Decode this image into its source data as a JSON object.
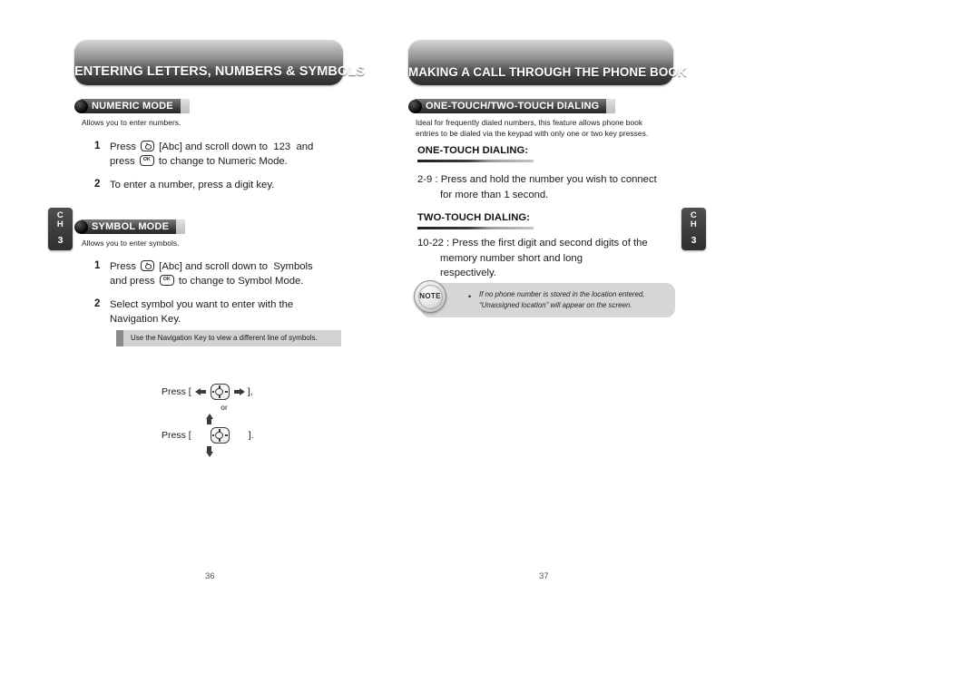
{
  "document": {
    "type": "phone-user-manual-spread"
  },
  "left_page": {
    "banner_title": "ENTERING LETTERS, NUMBERS & SYMBOLS",
    "page_number": "36",
    "chapter_tab": {
      "line1": "C",
      "line2": "H",
      "number": "3"
    },
    "sections": [
      {
        "badge_label": "NUMERIC MODE",
        "lead": "Allows you to enter numbers.",
        "steps": [
          {
            "num": "1",
            "parts": [
              {
                "kind": "text",
                "value": "Press "
              },
              {
                "kind": "key",
                "icon": "nav-key-icon"
              },
              {
                "kind": "text",
                "value": " [Abc] and scroll down to  123  and"
              },
              {
                "kind": "break"
              },
              {
                "kind": "text",
                "value": "press "
              },
              {
                "kind": "key",
                "icon": "ok-key-icon"
              },
              {
                "kind": "text",
                "value": " to change to Numeric Mode."
              }
            ]
          },
          {
            "num": "2",
            "parts": [
              {
                "kind": "text",
                "value": "To enter a number, press a digit key."
              }
            ]
          }
        ]
      },
      {
        "badge_label": "SYMBOL MODE",
        "lead": "Allows you to enter symbols.",
        "steps": [
          {
            "num": "1",
            "parts": [
              {
                "kind": "text",
                "value": "Press "
              },
              {
                "kind": "key",
                "icon": "nav-key-icon"
              },
              {
                "kind": "text",
                "value": " [Abc] and scroll down to  Symbols"
              },
              {
                "kind": "break"
              },
              {
                "kind": "text",
                "value": "and press "
              },
              {
                "kind": "key",
                "icon": "ok-key-icon"
              },
              {
                "kind": "text",
                "value": " to change to Symbol Mode."
              }
            ]
          },
          {
            "num": "2",
            "parts": [
              {
                "kind": "text",
                "value": "Select symbol you want to enter with the"
              },
              {
                "kind": "break"
              },
              {
                "kind": "text",
                "value": "Navigation Key."
              }
            ]
          }
        ]
      }
    ],
    "tip": "Use the Navigation Key to view a different line of symbols.",
    "nav_illustration": {
      "row1_press": "Press [",
      "row1_close": "],",
      "or_label": "or",
      "row2_press": "Press [",
      "row2_close": "]."
    }
  },
  "right_page": {
    "banner_title": "MAKING A CALL THROUGH THE PHONE BOOK",
    "page_number": "37",
    "chapter_tab": {
      "line1": "C",
      "line2": "H",
      "number": "3"
    },
    "badge_label": "ONE-TOUCH/TWO-TOUCH DIALING",
    "lead_line1": "Ideal for frequently dialed numbers, this feature allows phone book",
    "lead_line2": "entries to be dialed via the keypad with only one or two key presses.",
    "subsections": [
      {
        "heading": "ONE-TOUCH DIALING:",
        "lines": [
          "2-9 : Press and hold the number you wish to connect",
          "for more than 1 second."
        ]
      },
      {
        "heading": "TWO-TOUCH DIALING:",
        "lines": [
          "10-22 : Press the first digit and second digits of the",
          "memory number short and long",
          "respectively."
        ]
      }
    ],
    "note": {
      "medallion_label": "NOTE",
      "bullet": "•",
      "line1": "If no phone number is stored in the location entered,",
      "line2": "“Unassigned location” will appear on the screen."
    }
  },
  "colors": {
    "banner_dark": "#2c2c2c",
    "banner_light": "#d8d8d8",
    "badge_bar": "#343434",
    "tip_bg": "#d2d2d2",
    "note_bg": "#d6d6d6",
    "chapter_tab": "#3c3c3c"
  }
}
